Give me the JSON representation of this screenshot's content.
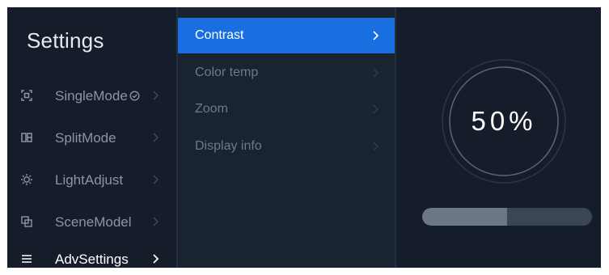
{
  "app": {
    "title": "Settings"
  },
  "sidebar": {
    "items": [
      {
        "label": "SingleMode",
        "icon": "single-mode-icon",
        "status": "check-circle-icon",
        "active": false
      },
      {
        "label": "SplitMode",
        "icon": "split-mode-icon",
        "active": false
      },
      {
        "label": "LightAdjust",
        "icon": "light-adjust-icon",
        "active": false
      },
      {
        "label": "SceneModel",
        "icon": "scene-model-icon",
        "active": false
      },
      {
        "label": "AdvSettings",
        "icon": "menu-icon",
        "active": true
      }
    ]
  },
  "submenu": {
    "items": [
      {
        "label": "Contrast",
        "active": true
      },
      {
        "label": "Color temp",
        "active": false
      },
      {
        "label": "Zoom",
        "active": false
      },
      {
        "label": "Display info",
        "active": false
      }
    ]
  },
  "value": {
    "display": "50%",
    "level": 0.5
  },
  "colors": {
    "background": "#151d2a",
    "submenu_background": "#1a2330",
    "accent": "#1a6fe0",
    "bar_track": "#3a4656",
    "bar_fill": "#6b7686"
  }
}
